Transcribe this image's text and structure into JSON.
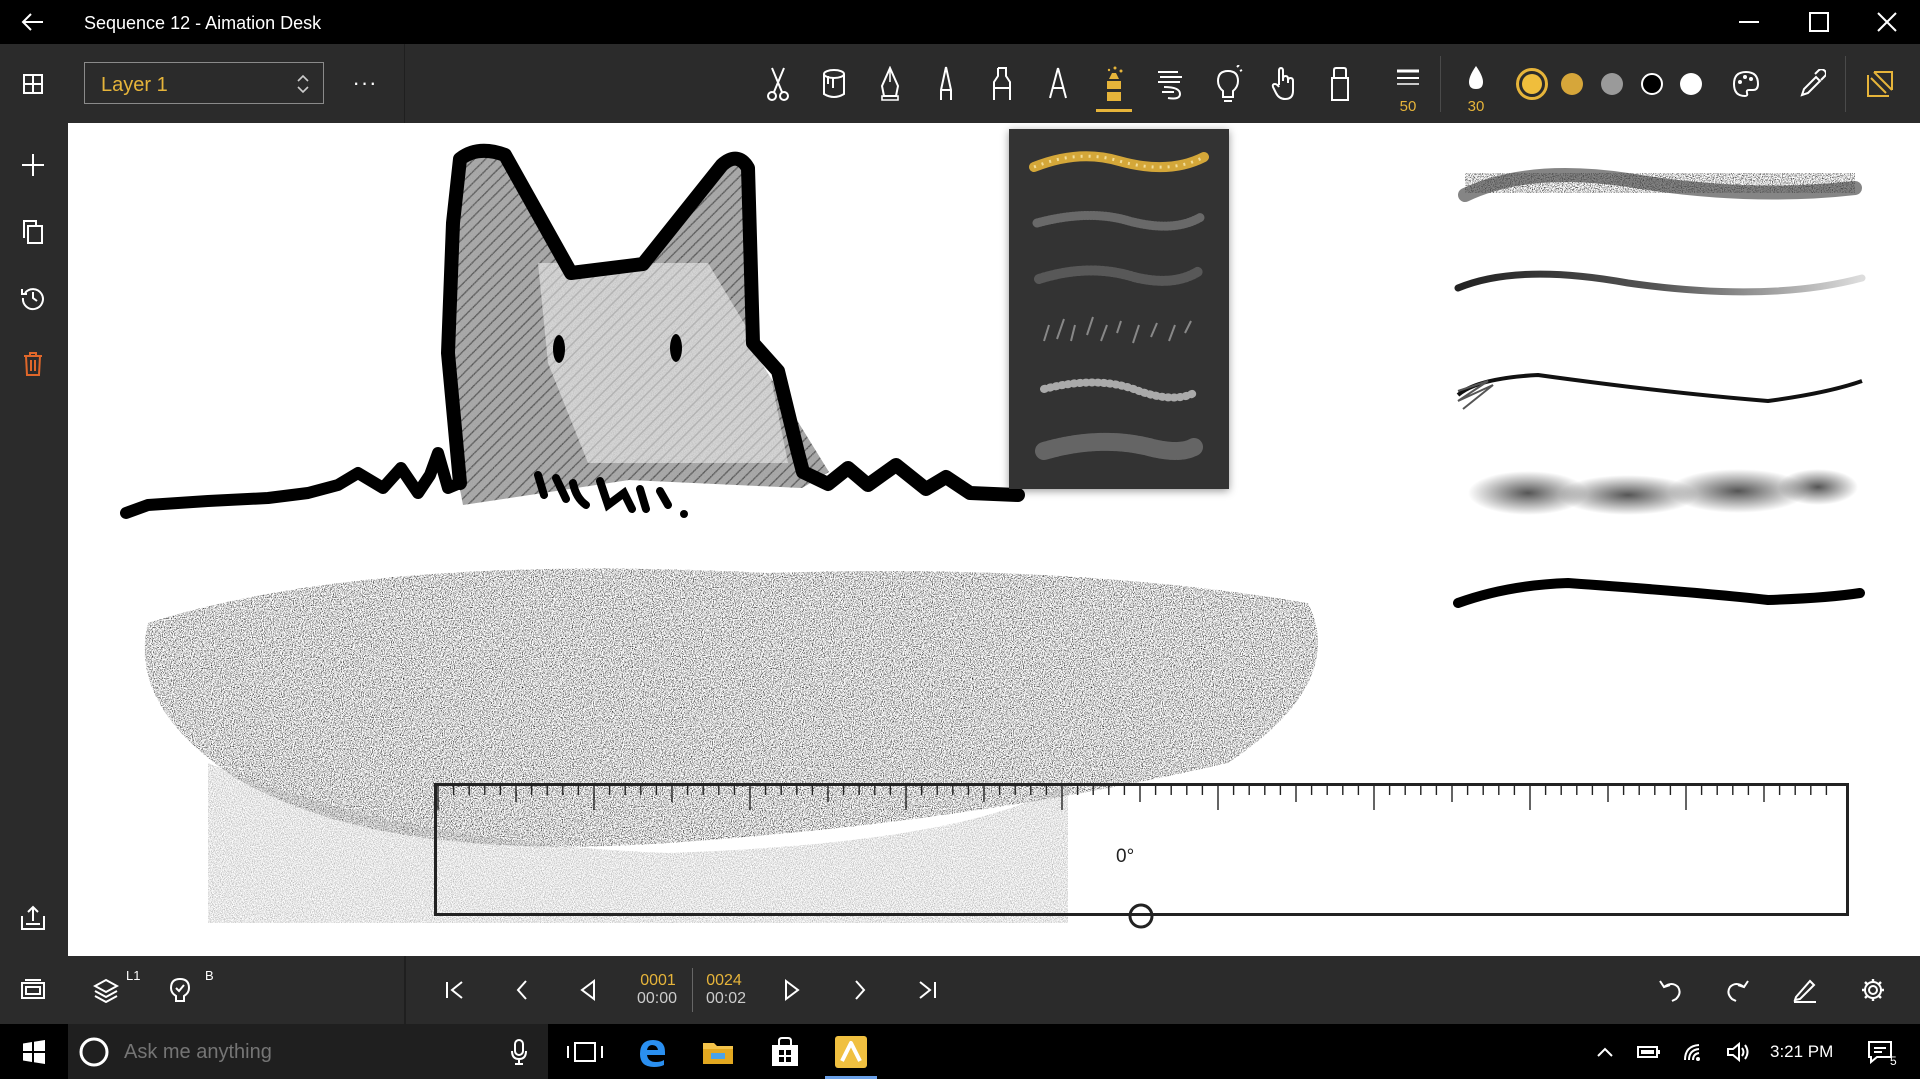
{
  "window": {
    "title": "Sequence 12 - Aimation Desk"
  },
  "toolbar": {
    "layer_name": "Layer 1",
    "more_label": "···",
    "tools": [
      "scissors",
      "bucket",
      "pen",
      "technical-pen",
      "marker",
      "calligraphy",
      "fx-brush",
      "blur",
      "light",
      "finger",
      "eraser"
    ],
    "active_tool": "fx-brush",
    "brush_size": "50",
    "opacity": "30",
    "colors": [
      "#f0be3c",
      "#d6a63a",
      "#9a9a9a",
      "#000000",
      "#ffffff"
    ]
  },
  "canvas": {
    "ruler_angle": "0°"
  },
  "timeline": {
    "layer_tag": "L1",
    "onion_tag": "B",
    "current_frame": "0001",
    "current_time": "00:00",
    "total_frames": "0024",
    "total_time": "00:02"
  },
  "taskbar": {
    "search_placeholder": "Ask me anything",
    "time": "3:21 PM",
    "notifications": "5"
  },
  "accent_color": "#e6b43a"
}
